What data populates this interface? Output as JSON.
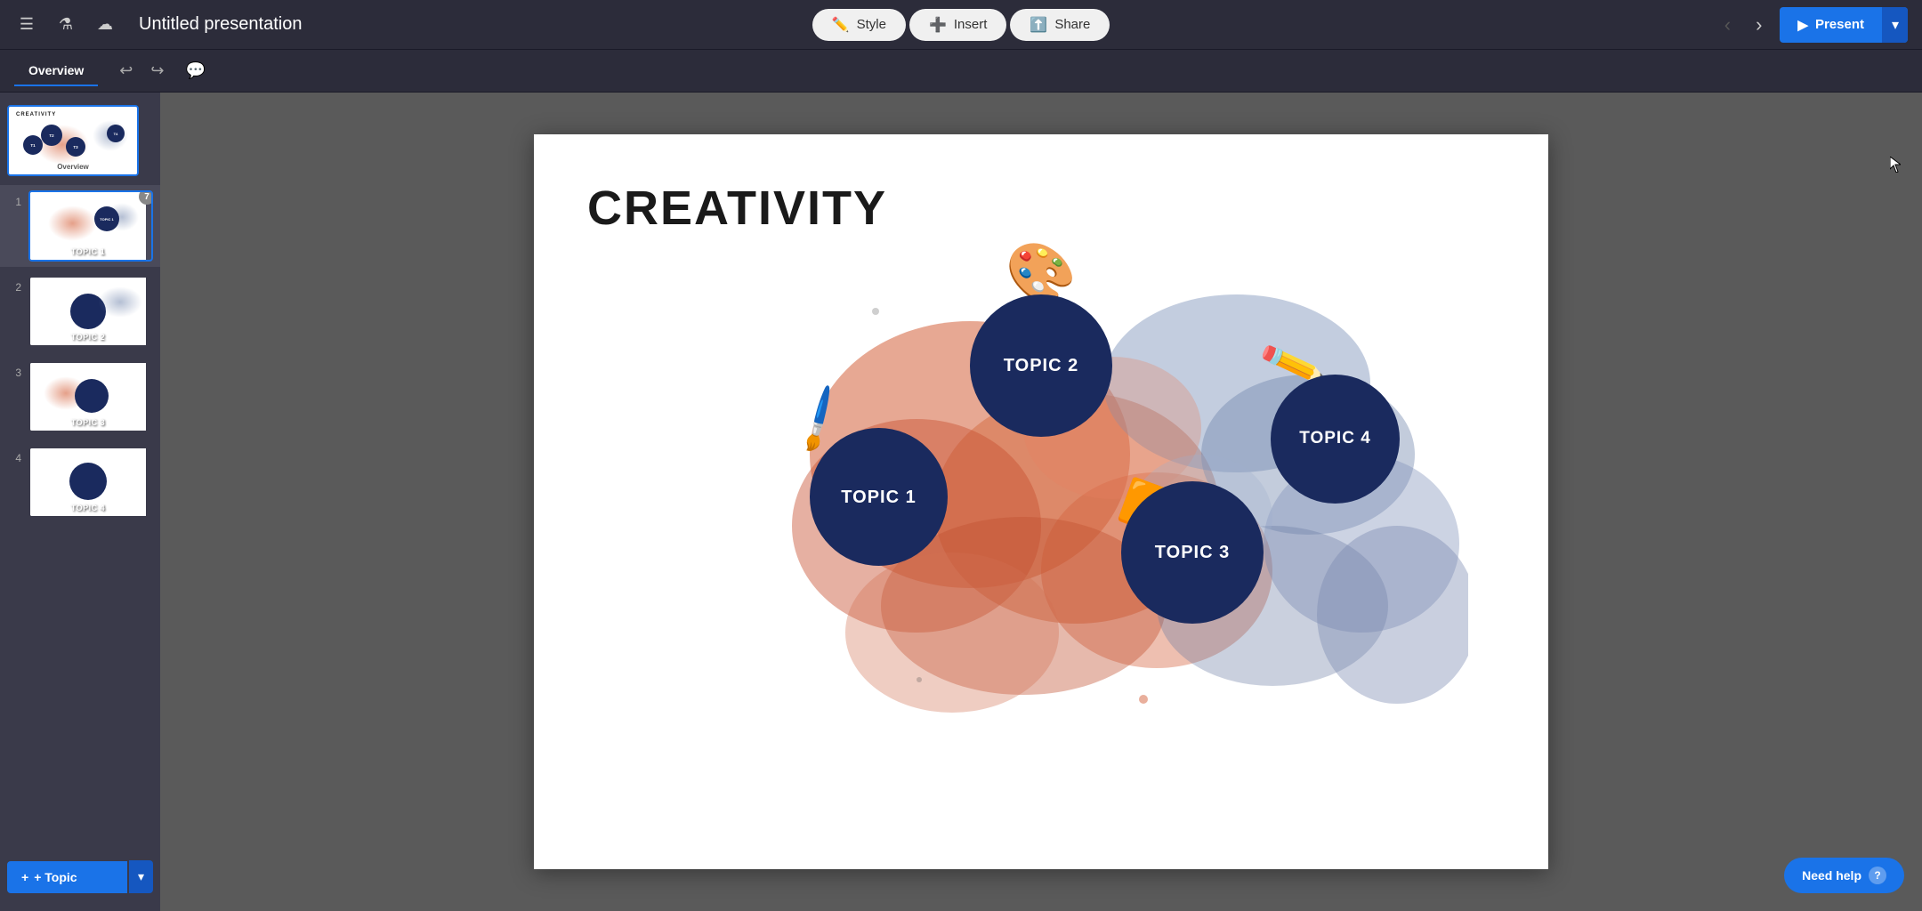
{
  "app": {
    "menu_icon": "☰",
    "flask_icon": "⚗",
    "cloud_icon": "☁",
    "title": "Untitled presentation"
  },
  "toolbar": {
    "style_label": "Style",
    "insert_label": "Insert",
    "share_label": "Share",
    "style_icon": "✏",
    "insert_icon": "+",
    "share_icon": "↑",
    "prev_icon": "‹",
    "next_icon": "›",
    "present_label": "Present",
    "present_play_icon": "▶"
  },
  "secondbar": {
    "overview_label": "Overview",
    "undo_icon": "↩",
    "redo_icon": "↪",
    "comment_icon": "💬"
  },
  "sidebar": {
    "overview_label": "Overview",
    "slides": [
      {
        "number": "1",
        "label": "TOPIC 1",
        "badge": "7"
      },
      {
        "number": "2",
        "label": "TOPIC 2",
        "badge": null
      },
      {
        "number": "3",
        "label": "TOPIC 3",
        "badge": null
      },
      {
        "number": "4",
        "label": "TOPIC 4",
        "badge": null
      }
    ],
    "add_topic_label": "+ Topic",
    "add_topic_dropdown": "▾"
  },
  "slide": {
    "title": "CREATIVITY",
    "topics": [
      {
        "id": "topic1",
        "label": "TOPIC 1"
      },
      {
        "id": "topic2",
        "label": "TOPIC 2"
      },
      {
        "id": "topic3",
        "label": "TOPIC 3"
      },
      {
        "id": "topic4",
        "label": "TOPIC 4"
      }
    ]
  },
  "help": {
    "label": "Need help",
    "icon": "?"
  },
  "colors": {
    "dark_navy": "#1a2a5e",
    "brand_blue": "#1a73e8",
    "orange_blob": "#d4603a",
    "blue_blob": "#6a7fa8"
  }
}
